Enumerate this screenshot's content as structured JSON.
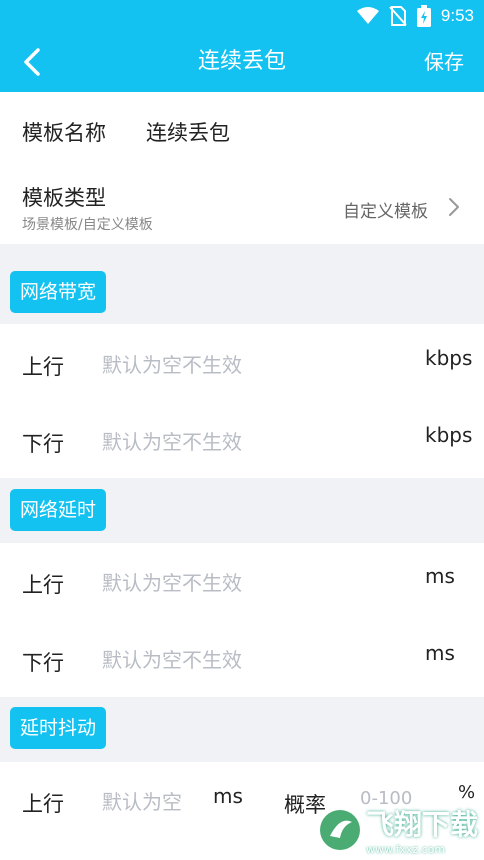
{
  "status_bar": {
    "time": "9:53"
  },
  "app_bar": {
    "title": "连续丢包",
    "save_label": "保存"
  },
  "template": {
    "name_label": "模板名称",
    "name_value": "连续丢包",
    "type_label": "模板类型",
    "type_sub": "场景模板/自定义模板",
    "type_value": "自定义模板"
  },
  "sections": [
    {
      "title": "网络带宽",
      "rows": [
        {
          "label": "上行",
          "placeholder": "默认为空不生效",
          "unit": "kbps"
        },
        {
          "label": "下行",
          "placeholder": "默认为空不生效",
          "unit": "kbps"
        }
      ]
    },
    {
      "title": "网络延时",
      "rows": [
        {
          "label": "上行",
          "placeholder": "默认为空不生效",
          "unit": "ms"
        },
        {
          "label": "下行",
          "placeholder": "默认为空不生效",
          "unit": "ms"
        }
      ]
    },
    {
      "title": "延时抖动",
      "rows": [
        {
          "label": "上行",
          "placeholder": "默认为空",
          "unit": "ms",
          "prob_label": "概率",
          "prob_placeholder": "0-100",
          "prob_unit": "%"
        }
      ]
    }
  ],
  "watermark": {
    "text": "飞翔下载",
    "sub": "www.fxxz.com"
  },
  "colors": {
    "accent": "#13c2f0",
    "background": "#f1f2f5"
  }
}
